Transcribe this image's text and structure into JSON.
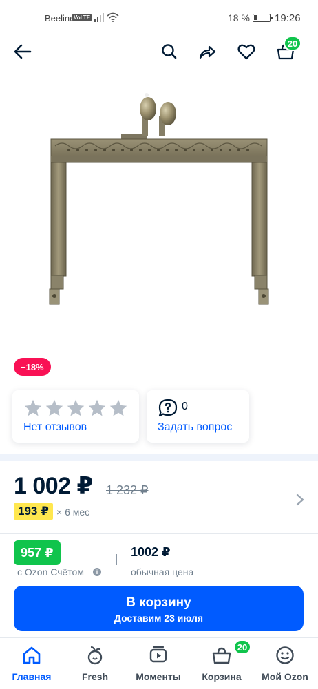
{
  "status_bar": {
    "carrier": "Beeline",
    "volte": "VoLTE",
    "battery_percent": "18 %",
    "time": "19:26"
  },
  "toolbar": {
    "cart_count": "20"
  },
  "product": {
    "discount": "−18%",
    "reviews_label": "Нет отзывов",
    "questions_count": "0",
    "ask_question_label": "Задать вопрос"
  },
  "price": {
    "current": "1 002 ₽",
    "old": "1 232 ₽",
    "installment_amount": "193 ₽",
    "installment_term": "× 6 мес",
    "ozon_price": "957 ₽",
    "ozon_price_label": "с Ozon Счётом",
    "regular_price": "1002 ₽",
    "regular_label": "обычная цена"
  },
  "cart_button": {
    "label": "В корзину",
    "delivery": "Доставим 23 июля"
  },
  "bottom_nav": {
    "items": [
      {
        "label": "Главная"
      },
      {
        "label": "Fresh"
      },
      {
        "label": "Моменты"
      },
      {
        "label": "Корзина"
      },
      {
        "label": "Мой Ozon"
      }
    ],
    "cart_badge": "20"
  },
  "colors": {
    "brand_blue": "#005bff",
    "discount_red": "#f91155",
    "ozon_green": "#10c44c",
    "installment_yellow": "#ffe74f"
  }
}
